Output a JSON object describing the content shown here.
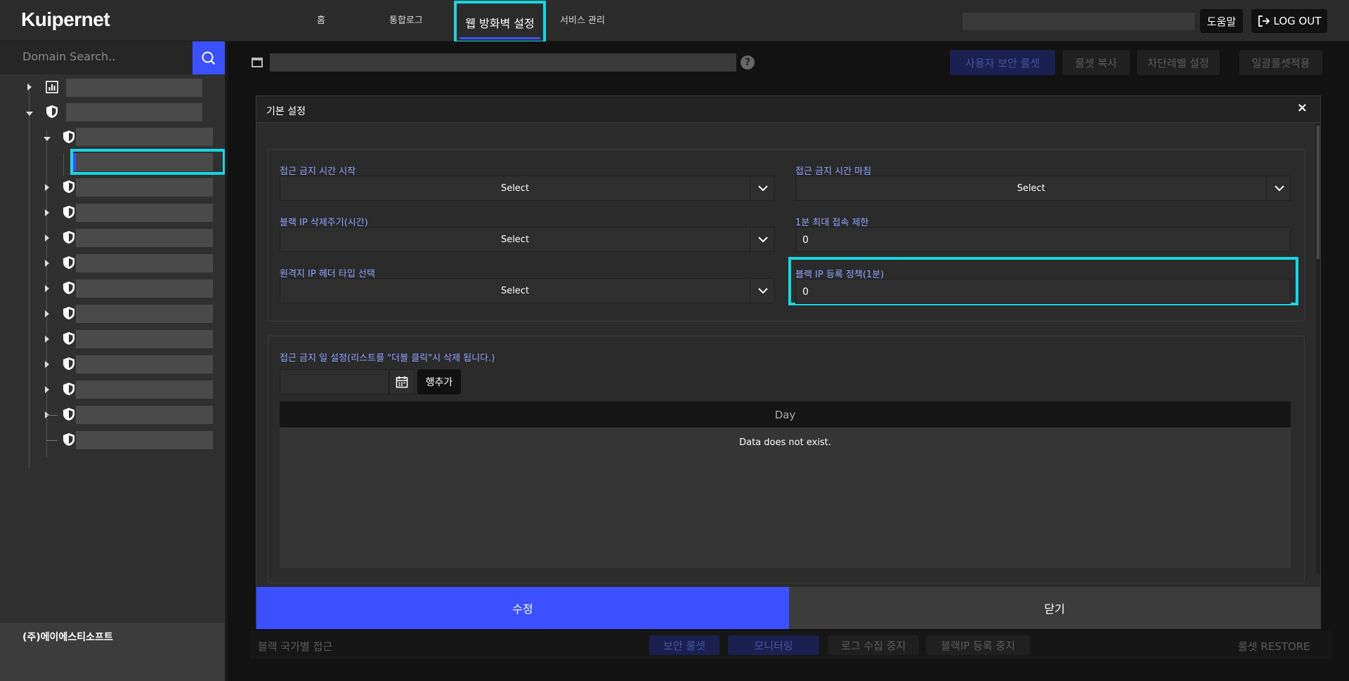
{
  "header": {
    "logo": "Kuipernet",
    "nav": [
      "홈",
      "통합로그",
      "웹 방화벽 설정",
      "서비스 관리"
    ],
    "help_label": "도움말",
    "logout_label": "LOG OUT"
  },
  "sidebar": {
    "search_placeholder": "Domain Search..",
    "company": "(주)에이에스티소프트"
  },
  "background": {
    "toolbar": [
      "사용자 보안 룰셋",
      "룰셋 복사",
      "차단레벨 설정",
      "일괄룰셋적용"
    ],
    "footer_label": "블랙 국가별 접근",
    "footer_buttons": [
      "보안 룰셋",
      "모니터링",
      "로그 수집 중지",
      "블랙IP 등록 중지"
    ],
    "restore": "룰셋 RESTORE"
  },
  "modal": {
    "title": "기본 설정",
    "close": "×",
    "fields": {
      "block_start_label": "접근 금지 시간 시작",
      "block_start_value": "Select",
      "block_end_label": "접근 금지 시간 마침",
      "block_end_value": "Select",
      "black_ip_delete_label": "블랙 IP 삭제주기(시간)",
      "black_ip_delete_value": "Select",
      "max_conn_label": "1분 최대 접속 제한",
      "max_conn_value": "0",
      "remote_ip_header_label": "원격지 IP 헤더 타입 선택",
      "remote_ip_header_value": "Select",
      "black_ip_policy_label": "블랙 IP 등록 정책(1분)",
      "black_ip_policy_value": "0"
    },
    "day_section": {
      "label": "접근 금지 일 설정(리스트를 \"더블 클릭\"시 삭제 됩니다.)",
      "add_row": "행추가",
      "column": "Day",
      "empty": "Data does not exist."
    },
    "submit": "수정",
    "cancel": "닫기"
  },
  "colors": {
    "accent": "#3b51ff",
    "highlight": "#19d6e0",
    "label": "#8fa3ff"
  }
}
